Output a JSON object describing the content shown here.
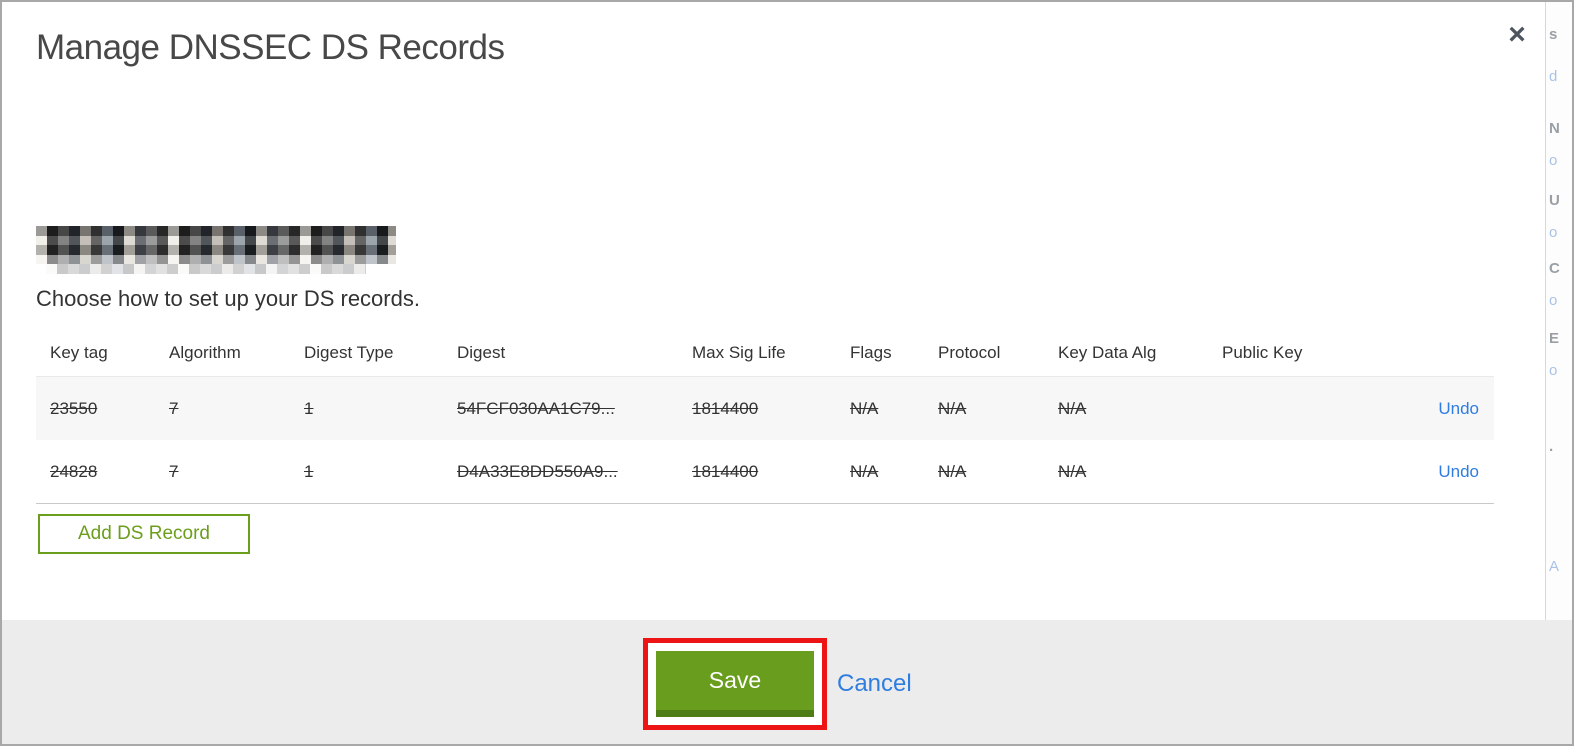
{
  "modal": {
    "title": "Manage DNSSEC DS Records",
    "close_label": "×",
    "instruction": "Choose how to set up your DS records.",
    "table": {
      "headers": [
        "Key tag",
        "Algorithm",
        "Digest Type",
        "Digest",
        "Max Sig Life",
        "Flags",
        "Protocol",
        "Key Data Alg",
        "Public Key"
      ],
      "rows": [
        {
          "key_tag": "23550",
          "algorithm": "7",
          "digest_type": "1",
          "digest": "54FCF030AA1C79...",
          "max_sig_life": "1814400",
          "flags": "N/A",
          "protocol": "N/A",
          "key_data_alg": "N/A",
          "public_key": "",
          "action": "Undo",
          "state": "marked-for-deletion"
        },
        {
          "key_tag": "24828",
          "algorithm": "7",
          "digest_type": "1",
          "digest": "D4A33E8DD550A9...",
          "max_sig_life": "1814400",
          "flags": "N/A",
          "protocol": "N/A",
          "key_data_alg": "N/A",
          "public_key": "",
          "action": "Undo",
          "state": "marked-for-deletion"
        }
      ]
    },
    "add_record_button": "Add DS Record",
    "footer": {
      "save_button": "Save",
      "cancel_link": "Cancel"
    }
  },
  "annotation": {
    "shape": "red-rectangle-highlight",
    "target": "save-button",
    "color": "#ec1414"
  },
  "background_strip": {
    "fragments": [
      {
        "text": "s"
      },
      {
        "text": "d"
      },
      {
        "text": "N"
      },
      {
        "text": "o"
      },
      {
        "text": "U"
      },
      {
        "text": "o"
      },
      {
        "text": "C"
      },
      {
        "text": "o"
      },
      {
        "text": "E"
      },
      {
        "text": "o"
      },
      {
        "text": "."
      },
      {
        "text": "A"
      }
    ]
  },
  "colors": {
    "accent_green": "#699d1d",
    "accent_green_dark": "#4f7d15",
    "outline_green": "#6b9e1c",
    "link_blue": "#2f7de1",
    "annotation_red": "#ec1414",
    "footer_gray": "#ececec",
    "row_stripe": "#f7f7f7",
    "border_gray": "#a8a8a8"
  }
}
